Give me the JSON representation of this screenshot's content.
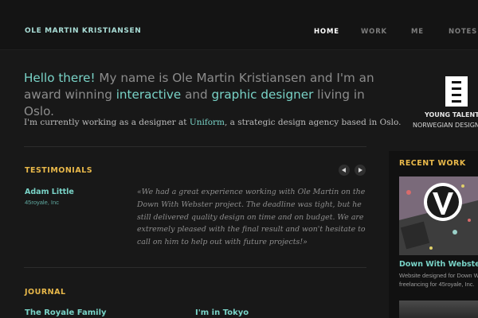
{
  "header": {
    "brand": "OLE MARTIN KRISTIANSEN",
    "nav": [
      "HOME",
      "WORK",
      "ME",
      "NOTES"
    ]
  },
  "intro": {
    "p1": "Hello there!",
    "p2": " My name is Ole Martin Kristiansen and I'm an award winning ",
    "p3": "interactive",
    "p4": " and ",
    "p5": "graphic designer",
    "p6": " living in Oslo."
  },
  "sub": {
    "pre": "I'm currently working as a designer at ",
    "link": "Uniform",
    "post": ", a strategic design agency based in Oslo."
  },
  "testimonials": {
    "title": "TESTIMONIALS",
    "author": "Adam Little",
    "company": "45royale, Inc",
    "quote": "«We had a great experience working with Ole Martin on the Down With Webster project. The deadline was tight, but he still delivered quality design on time and on budget. We are extremely pleased with the final result and won't hesitate to call on him to help out with future projects!»"
  },
  "journal": {
    "title": "JOURNAL",
    "items": [
      "The Royale Family",
      "I'm in Tokyo"
    ]
  },
  "award": {
    "line1": "YOUNG TALENT A",
    "line2": "NORWEGIAN DESIGN"
  },
  "recent_work": {
    "title": "RECENT WORK",
    "item_title": "Down With Webster",
    "desc1": "Website designed for Down With",
    "desc2": "freelancing for 45royale, Inc."
  },
  "colors": {
    "accent": "#79d3c7",
    "heading": "#e8b84a",
    "background": "#181818"
  }
}
